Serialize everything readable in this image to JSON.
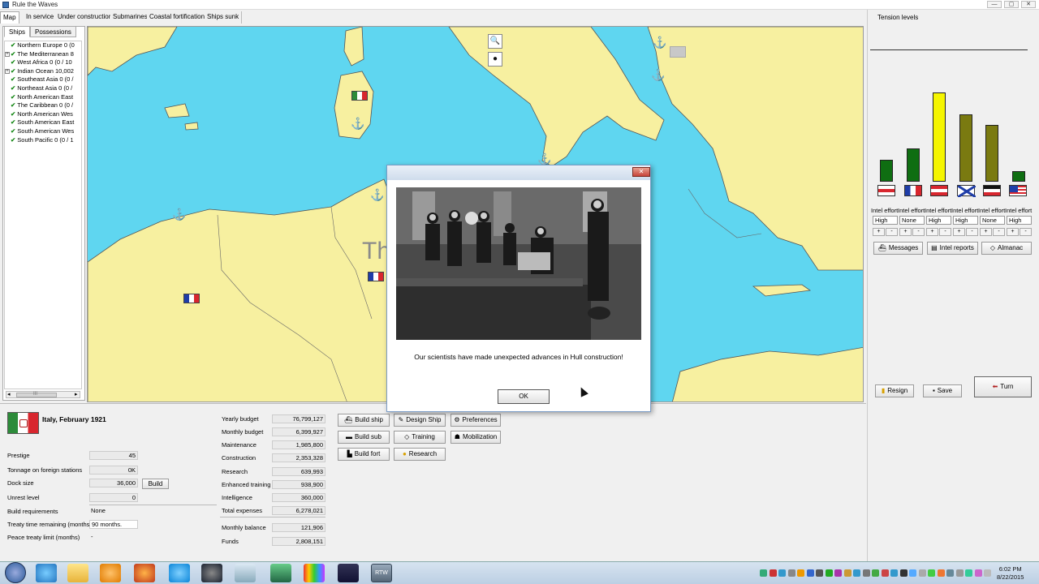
{
  "window": {
    "title": "Rule the Waves",
    "minimize": "—",
    "maximize": "▢",
    "close": "✕"
  },
  "main_tabs": [
    "Map",
    "In service",
    "Under construction",
    "Submarines",
    "Coastal fortifications",
    "Ships sunk"
  ],
  "left_tabs": [
    "Ships",
    "Possessions"
  ],
  "regions": [
    {
      "label": "Northern Europe 0 (0",
      "expandable": false
    },
    {
      "label": "The Mediterranean 8",
      "expandable": true
    },
    {
      "label": "West Africa 0 (0 / 10",
      "expandable": false
    },
    {
      "label": "Indian Ocean 10,002",
      "expandable": true
    },
    {
      "label": "Southeast Asia 0 (0 /",
      "expandable": false
    },
    {
      "label": "Northeast Asia 0 (0 /",
      "expandable": false
    },
    {
      "label": "North American East",
      "expandable": false
    },
    {
      "label": "The Caribbean 0 (0 /",
      "expandable": false
    },
    {
      "label": "North American Wes",
      "expandable": false
    },
    {
      "label": "South American East",
      "expandable": false
    },
    {
      "label": "South American Wes",
      "expandable": false
    },
    {
      "label": "South Pacific 0 (0 / 1",
      "expandable": false
    }
  ],
  "scrollbar": {
    "left_arrow": "◂",
    "grip": "III",
    "right_arrow": "▸"
  },
  "map": {
    "label_partial": "Th",
    "zoom_icon": "magnifier-icon",
    "zoom_glyph": "🔍",
    "drop_icon": "drop-icon",
    "drop_glyph": "●",
    "anchor_glyph": "⚓",
    "colors": {
      "sea": "#5fd6f0",
      "land": "#f7f0a0",
      "coast": "#555555"
    }
  },
  "right_panel": {
    "tension_title": "Tension levels",
    "tension_bars": [
      {
        "nation": "Britain",
        "level": 0.23,
        "color": "#0f6e12"
      },
      {
        "nation": "France",
        "level": 0.35,
        "color": "#0f6e12"
      },
      {
        "nation": "Austria-Hungary",
        "level": 0.93,
        "color": "#f5f500"
      },
      {
        "nation": "Russia",
        "level": 0.7,
        "color": "#7a7a10"
      },
      {
        "nation": "Germany",
        "level": 0.59,
        "color": "#7a7a10"
      },
      {
        "nation": "USA",
        "level": 0.11,
        "color": "#0f6e12"
      }
    ],
    "intel_label": "Intel effort",
    "intel_values": [
      "High",
      "None",
      "High",
      "High",
      "None",
      "High"
    ],
    "plus": "+",
    "minus": "-",
    "buttons": {
      "messages": "Messages",
      "intel_reports": "Intel reports",
      "almanac": "Almanac",
      "resign": "Resign",
      "save": "Save",
      "turn": "Turn"
    }
  },
  "nation": {
    "title": "Italy, February 1921",
    "stats": [
      {
        "label": "Prestige",
        "value": "45"
      },
      {
        "label": "Tonnage on foreign stations",
        "value": "0K"
      },
      {
        "label": "Dock size",
        "value": "36,000"
      },
      {
        "label": "Unrest level",
        "value": "0"
      },
      {
        "label": "Build requirements",
        "value": "None"
      },
      {
        "label": "Treaty time remaining (months)",
        "value": "90 months."
      },
      {
        "label": "Peace treaty limit (months)",
        "value": "-"
      }
    ],
    "build_label": "Build"
  },
  "budget": [
    {
      "label": "Yearly budget",
      "value": "76,799,127"
    },
    {
      "label": "Monthly budget",
      "value": "6,399,927"
    },
    {
      "label": "Maintenance",
      "value": "1,985,800"
    },
    {
      "label": "Construction",
      "value": "2,353,328"
    },
    {
      "label": "Research",
      "value": "639,993"
    },
    {
      "label": "Enhanced training",
      "value": "938,900"
    },
    {
      "label": "Intelligence",
      "value": "360,000"
    },
    {
      "label": "Total expenses",
      "value": "6,278,021"
    },
    {
      "label": "Monthly balance",
      "value": "121,906"
    },
    {
      "label": "Funds",
      "value": "2,808,151"
    }
  ],
  "actions": {
    "build_ship": "Build ship",
    "design_ship": "Design Ship",
    "preferences": "Preferences",
    "build_sub": "Build sub",
    "training": "Training",
    "mobilization": "Mobilization",
    "build_fort": "Build fort",
    "research": "Research"
  },
  "dialog": {
    "message": "Our scientists have made unexpected advances in Hull construction!",
    "ok": "OK",
    "close": "✕"
  },
  "taskbar": {
    "time": "6:02 PM",
    "date": "8/22/2015",
    "rtw_label": "RTW"
  }
}
